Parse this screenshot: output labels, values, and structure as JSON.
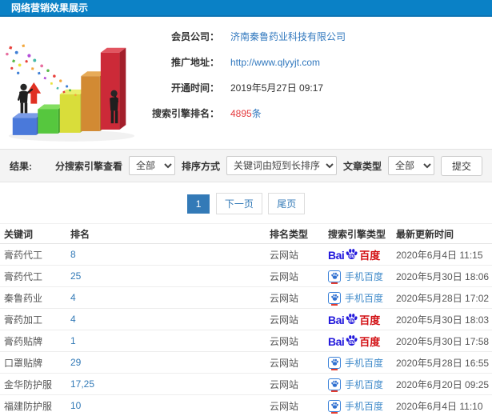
{
  "header": {
    "title": "网络营销效果展示"
  },
  "info": {
    "company_label": "会员公司：",
    "company_value": "济南秦鲁药业科技有限公司",
    "url_label": "推广地址：",
    "url_value": "http://www.qlyyjt.com",
    "open_time_label": "开通时间：",
    "open_time_value": "2019年5月27日 09:17",
    "rank_label": "搜索引擎排名：",
    "rank_count": "4895",
    "rank_unit": "条"
  },
  "filters": {
    "result_label": "结果:",
    "engine_view_label": "分搜索引擎查看",
    "engine_view_value": "全部",
    "sort_label": "排序方式",
    "sort_value": "关键词由短到长排序",
    "article_label": "文章类型",
    "article_value": "全部",
    "submit_label": "提交"
  },
  "pagination": {
    "current": "1",
    "next": "下一页",
    "last": "尾页"
  },
  "table": {
    "headers": [
      "关键词",
      "排名",
      "排名类型",
      "搜索引擎类型",
      "最新更新时间"
    ],
    "engine_logos": {
      "baidu_pc": {
        "latin": "Bai",
        "du": "du",
        "cn": "百度"
      },
      "baidu_mobile": {
        "label": "手机百度"
      }
    },
    "rows": [
      {
        "keyword": "膏药代工",
        "rank": "8",
        "rank_type": "云网站",
        "engine": "baidu_pc",
        "updated": "2020年6月4日 11:15"
      },
      {
        "keyword": "膏药代工",
        "rank": "25",
        "rank_type": "云网站",
        "engine": "baidu_mobile",
        "updated": "2020年5月30日 18:06"
      },
      {
        "keyword": "秦鲁药业",
        "rank": "4",
        "rank_type": "云网站",
        "engine": "baidu_mobile",
        "updated": "2020年5月28日 17:02"
      },
      {
        "keyword": "膏药加工",
        "rank": "4",
        "rank_type": "云网站",
        "engine": "baidu_pc",
        "updated": "2020年5月30日 18:03"
      },
      {
        "keyword": "膏药贴牌",
        "rank": "1",
        "rank_type": "云网站",
        "engine": "baidu_pc",
        "updated": "2020年5月30日 17:58"
      },
      {
        "keyword": "口罩贴牌",
        "rank": "29",
        "rank_type": "云网站",
        "engine": "baidu_mobile",
        "updated": "2020年5月28日 16:55"
      },
      {
        "keyword": "金华防护服",
        "rank": "17,25",
        "rank_type": "云网站",
        "engine": "baidu_mobile",
        "updated": "2020年6月20日 09:25"
      },
      {
        "keyword": "福建防护服",
        "rank": "10",
        "rank_type": "云网站",
        "engine": "baidu_mobile",
        "updated": "2020年6月4日 11:10"
      }
    ]
  },
  "colors": {
    "header_blue": "#0a81c6",
    "link_blue": "#3178be",
    "pagination_blue": "#337ab7",
    "rank_red": "#e4393c",
    "baidu_blue": "#2319dc",
    "baidu_red": "#d20f13"
  }
}
